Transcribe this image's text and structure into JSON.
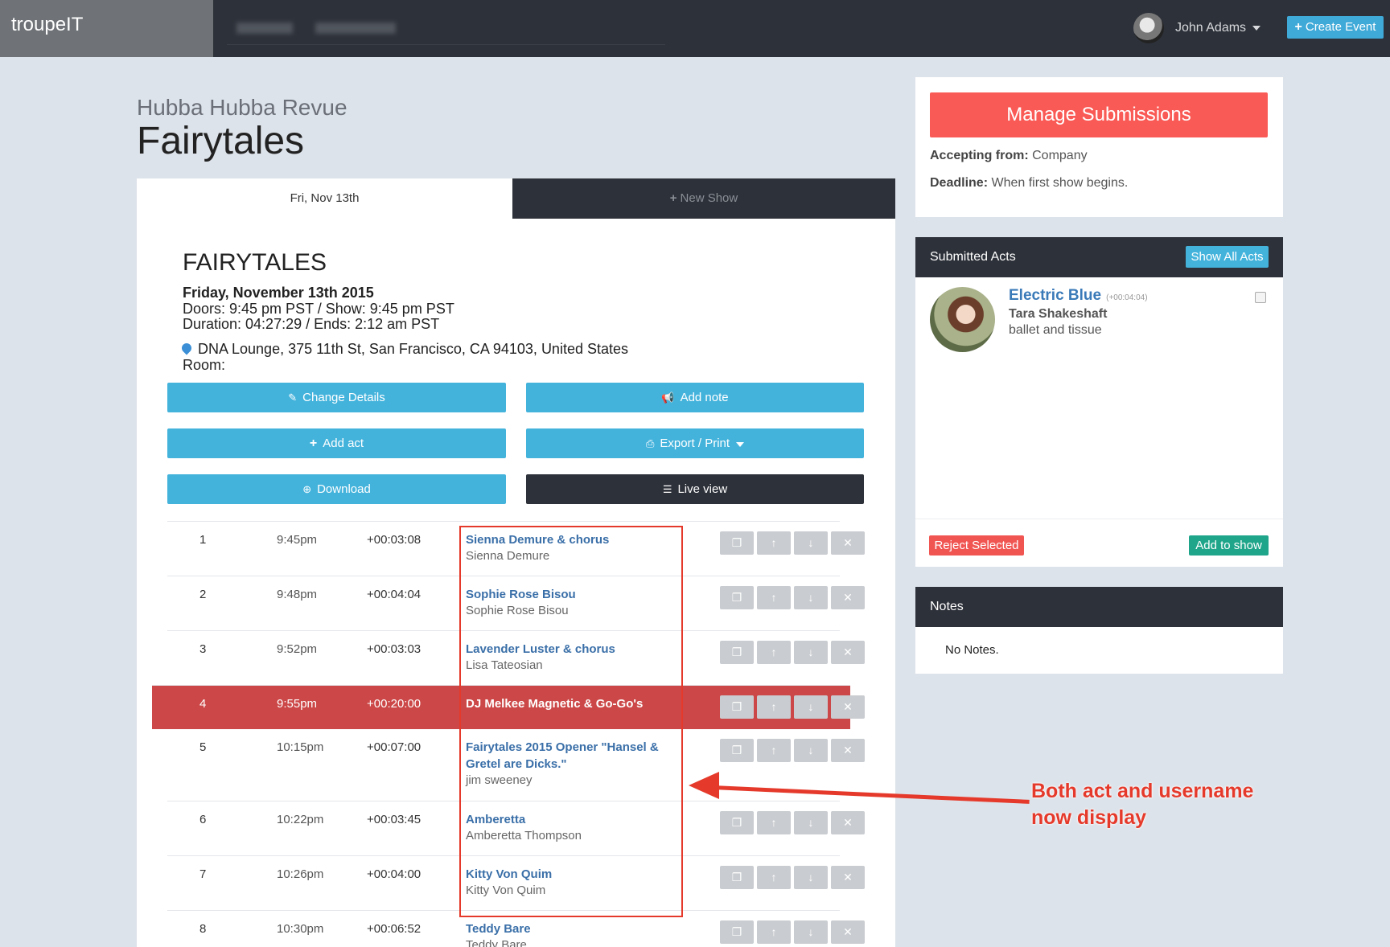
{
  "topbar": {
    "brand": "troupeIT",
    "user_name": "John Adams",
    "create_event_label": "Create Event"
  },
  "event": {
    "company": "Hubba Hubba Revue",
    "title": "Fairytales",
    "tabs": {
      "active": "Fri, Nov 13th",
      "new_show": "New Show"
    },
    "show_name": "FAIRYTALES",
    "date": "Friday, November 13th 2015",
    "doors_show": "Doors: 9:45 pm PST / Show: 9:45 pm PST",
    "duration_ends": "Duration: 04:27:29 / Ends: 2:12 am PST",
    "venue": "DNA Lounge, 375 11th St, San Francisco, CA 94103, United States",
    "room": "Room:"
  },
  "actions": {
    "change_details": "Change Details",
    "add_note": "Add note",
    "add_act": "Add act",
    "export_print": "Export / Print",
    "download": "Download",
    "live_view": "Live view"
  },
  "lineup": [
    {
      "num": "1",
      "time": "9:45pm",
      "duration": "+00:03:08",
      "act": "Sienna Demure & chorus",
      "performer": "Sienna Demure"
    },
    {
      "num": "2",
      "time": "9:48pm",
      "duration": "+00:04:04",
      "act": "Sophie Rose Bisou",
      "performer": "Sophie Rose Bisou"
    },
    {
      "num": "3",
      "time": "9:52pm",
      "duration": "+00:03:03",
      "act": "Lavender Luster & chorus",
      "performer": "Lisa Tateosian"
    },
    {
      "num": "4",
      "time": "9:55pm",
      "duration": "+00:20:00",
      "act": "DJ Melkee Magnetic & Go-Go's",
      "performer": ""
    },
    {
      "num": "5",
      "time": "10:15pm",
      "duration": "+00:07:00",
      "act": "Fairytales 2015 Opener \"Hansel & Gretel are Dicks.\"",
      "performer": "jim sweeney"
    },
    {
      "num": "6",
      "time": "10:22pm",
      "duration": "+00:03:45",
      "act": "Amberetta",
      "performer": "Amberetta Thompson"
    },
    {
      "num": "7",
      "time": "10:26pm",
      "duration": "+00:04:00",
      "act": "Kitty Von Quim",
      "performer": "Kitty Von Quim"
    },
    {
      "num": "8",
      "time": "10:30pm",
      "duration": "+00:06:52",
      "act": "Teddy Bare",
      "performer": "Teddy Bare"
    }
  ],
  "annotation": {
    "line1": "Both act and username",
    "line2": "now display"
  },
  "submissions": {
    "manage_label": "Manage Submissions",
    "accepting_label": "Accepting from:",
    "accepting_value": "Company",
    "deadline_label": "Deadline:",
    "deadline_value": "When first show begins."
  },
  "submitted_acts": {
    "header": "Submitted Acts",
    "show_all_label": "Show All Acts",
    "item": {
      "title": "Electric Blue",
      "duration": "(+00:04:04)",
      "performer": "Tara Shakeshaft",
      "description": "ballet and tissue"
    },
    "reject_label": "Reject Selected",
    "add_label": "Add to show"
  },
  "notes": {
    "header": "Notes",
    "empty": "No Notes."
  }
}
